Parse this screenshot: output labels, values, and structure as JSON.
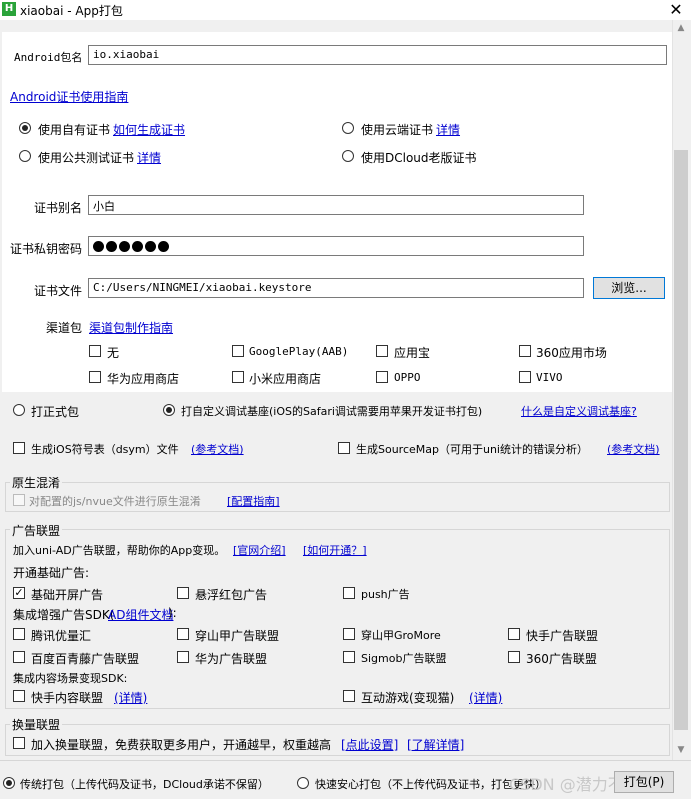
{
  "window": {
    "title": "xiaobai - App打包",
    "close_symbol": "✕",
    "app_icon": "H"
  },
  "android": {
    "package_label": "Android包名",
    "package_value": "io.xiaobai",
    "cert_guide_link": "Android证书使用指南",
    "cert_options": [
      {
        "label": "使用自有证书",
        "link": "如何生成证书",
        "selected": true
      },
      {
        "label": "使用云端证书",
        "link": "详情",
        "selected": false
      },
      {
        "label": "使用公共测试证书",
        "link": "详情",
        "selected": false
      },
      {
        "label": "使用DCloud老版证书",
        "link": "",
        "selected": false
      }
    ],
    "alias_label": "证书别名",
    "alias_value": "小白",
    "password_label": "证书私钥密码",
    "password_dots": 6,
    "file_label": "证书文件",
    "file_value": "C:/Users/NINGMEI/xiaobai.keystore",
    "browse_button": "浏览...",
    "channel_label": "渠道包",
    "channel_link": "渠道包制作指南",
    "channels": [
      "无",
      "GooglePlay(AAB)",
      "应用宝",
      "360应用市场",
      "华为应用商店",
      "小米应用商店",
      "OPPO",
      "VIVO"
    ]
  },
  "build_type": {
    "options": [
      {
        "label": "打正式包",
        "selected": false
      },
      {
        "label": "打自定义调试基座(iOS的Safari调试需要用苹果开发证书打包)",
        "selected": true
      }
    ],
    "link": "什么是自定义调试基座?"
  },
  "symbols": {
    "ios_dsym": "生成iOS符号表（dsym）文件",
    "ios_dsym_link": "(参考文档)",
    "sourcemap": "生成SourceMap（可用于uni统计的错误分析）",
    "sourcemap_link": "(参考文档)"
  },
  "native_obfuscation": {
    "title": "原生混淆",
    "option": "对配置的js/nvue文件进行原生混淆",
    "link": "[配置指南]"
  },
  "ad_union": {
    "title": "广告联盟",
    "intro": "加入uni-AD广告联盟，帮助你的App变现。",
    "intro_link_1": "[官网介绍]",
    "intro_link_2": "[如何开通？]",
    "basic_title": "开通基础广告:",
    "basic_options": [
      {
        "label": "基础开屏广告",
        "checked": true
      },
      {
        "label": "悬浮红包广告",
        "checked": false
      },
      {
        "label": "push广告",
        "checked": false
      }
    ],
    "enhanced_title_prefix": "集成增强广告SDK(",
    "enhanced_title_link": "AD组件文档",
    "enhanced_title_suffix": "):",
    "enhanced_options": [
      "腾讯优量汇",
      "穿山甲广告联盟",
      "穿山甲GroMore",
      "快手广告联盟",
      "百度百青藤广告联盟",
      "华为广告联盟",
      "Sigmob广告联盟",
      "360广告联盟"
    ],
    "content_title": "集成内容场景变现SDK:",
    "content_options": [
      {
        "label": "快手内容联盟",
        "link": "(详情)"
      },
      {
        "label": "互动游戏(变现猫)",
        "link": "(详情)"
      }
    ]
  },
  "exchange_union": {
    "title": "换量联盟",
    "option": "加入换量联盟，免费获取更多用户，开通越早，权重越高",
    "link_1": "[点此设置]",
    "link_2": "[了解详情]"
  },
  "packaging": {
    "options": [
      {
        "label": "传统打包（上传代码及证书，DCloud承诺不保留）",
        "selected": true
      },
      {
        "label": "快速安心打包（不上传代码及证书，打包更快）",
        "selected": false
      }
    ],
    "submit_button": "打包(P)",
    "watermark": "CSDN @潜力不小白"
  },
  "scrollbar": {
    "up": "▲",
    "down": "▼"
  }
}
